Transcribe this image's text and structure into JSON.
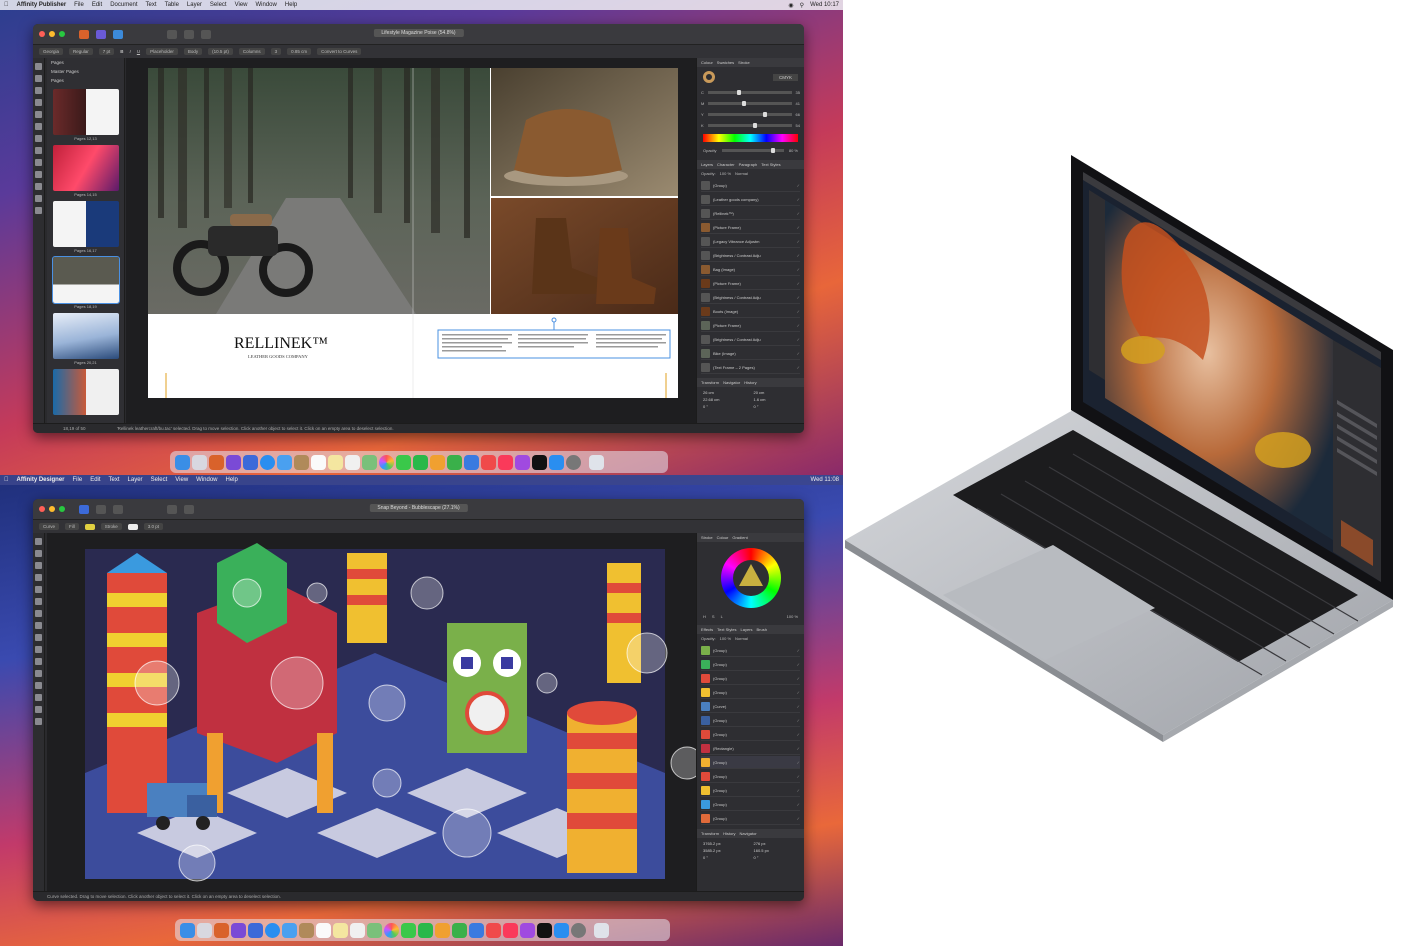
{
  "publisher": {
    "menubar": {
      "app": "Affinity Publisher",
      "items": [
        "File",
        "Edit",
        "Document",
        "Text",
        "Table",
        "Layer",
        "Select",
        "View",
        "Window",
        "Help"
      ],
      "clock": "Wed 10:17"
    },
    "document_title": "Lifestyle Magazine Poise (54.8%)",
    "context_bar": {
      "font": "Georgia",
      "weight": "Regular",
      "size": "7 pt",
      "placeholder": "Placeholder",
      "style": "Body",
      "leading": "(10.5 pt)",
      "columns_label": "Columns",
      "columns_value": "3",
      "gutter": "0.85 cm",
      "convert": "Convert to Curves"
    },
    "pages_panel": {
      "tab": "Pages",
      "master": "Master Pages",
      "pages": "Pages",
      "thumbs": [
        "Pages 12,13",
        "Pages 14,15",
        "Pages 16,17",
        "Pages 18,19",
        "Pages 20,21",
        ""
      ]
    },
    "spread": {
      "brand": "RELLINEK™",
      "tagline": "LEATHER GOODS COMPANY"
    },
    "colour_panel": {
      "tabs": [
        "Colour",
        "Swatches",
        "Stroke"
      ],
      "model": "CMYK",
      "values": [
        "35",
        "41",
        "66",
        "54"
      ],
      "labels": [
        "C",
        "M",
        "Y",
        "K"
      ],
      "opacity_label": "Opacity",
      "opacity": "80 %"
    },
    "layers_panel": {
      "tabs": [
        "Layers",
        "Character",
        "Paragraph",
        "Text Styles"
      ],
      "opacity_label": "Opacity:",
      "opacity": "100 %",
      "blend": "Normal",
      "rows": [
        "(Group)",
        "(Leather goods company)",
        "(Rellinek™)",
        "(Picture Frame)",
        "(Legacy Vibrance Adjustm",
        "(Brightness / Contrast Adju",
        "Bag (Image)",
        "(Picture Frame)",
        "(Brightness / Contrast Adju",
        "Boots (Image)",
        "(Picture Frame)",
        "(Brightness / Contrast Adju",
        "Bike (Image)",
        "(Text Frame – 2 Pages)"
      ]
    },
    "transform_panel": {
      "tabs": [
        "Transform",
        "Navigator",
        "History"
      ],
      "x": "26 cm",
      "y": "22.68 cm",
      "w": "20 cm",
      "h": "1.6 cm",
      "r": "0 °",
      "s": "0 °"
    },
    "status": "'Rellinek leathercraft/bu.tac' selected. Drag to move selection. Click another object to select it. Click on an empty area to deselect selection.",
    "page_nav": "18,19 of 50"
  },
  "designer": {
    "menubar": {
      "app": "Affinity Designer",
      "items": [
        "File",
        "Edit",
        "Text",
        "Layer",
        "Select",
        "View",
        "Window",
        "Help"
      ],
      "clock": "Wed 11:08"
    },
    "document_title": "Snap Beyond - Bubblescape (27.1%)",
    "context_bar": {
      "curve": "Curve",
      "fill": "Fill",
      "stroke": "Stroke",
      "width": "3.0 pt"
    },
    "right_tabs": [
      "Stroke",
      "Colour",
      "Gradient"
    ],
    "colour": {
      "h": "H",
      "s": "S",
      "l": "L",
      "opacity": "100 %"
    },
    "layers_panel": {
      "tabs": [
        "Effects",
        "Text Styles",
        "Layers",
        "Brush"
      ],
      "opacity_label": "Opacity:",
      "opacity": "100 %",
      "blend": "Normal",
      "rows": [
        "(Group)",
        "(Group)",
        "(Group)",
        "(Group)",
        "(Curve)",
        "(Group)",
        "(Group)",
        "(Rectangle)",
        "(Group)",
        "(Group)",
        "(Group)",
        "(Group)",
        "(Group)"
      ]
    },
    "transform_panel": {
      "tabs": [
        "Transform",
        "History",
        "Navigator"
      ],
      "x": "3765.2 px",
      "y": "3585.2 px",
      "w": "276 px",
      "h": "160.5 px",
      "r": "0 °",
      "s": "0 °"
    },
    "status": "Curve selected. Drag to move selection. Click another object to select it. Click on an empty area to deselect selection."
  },
  "dock_icon_count": 24,
  "colors": {
    "window": "#2a2a2d",
    "panel": "#2e2e32",
    "accent": "#4a90e2",
    "laptop": "#c0c2c6"
  }
}
